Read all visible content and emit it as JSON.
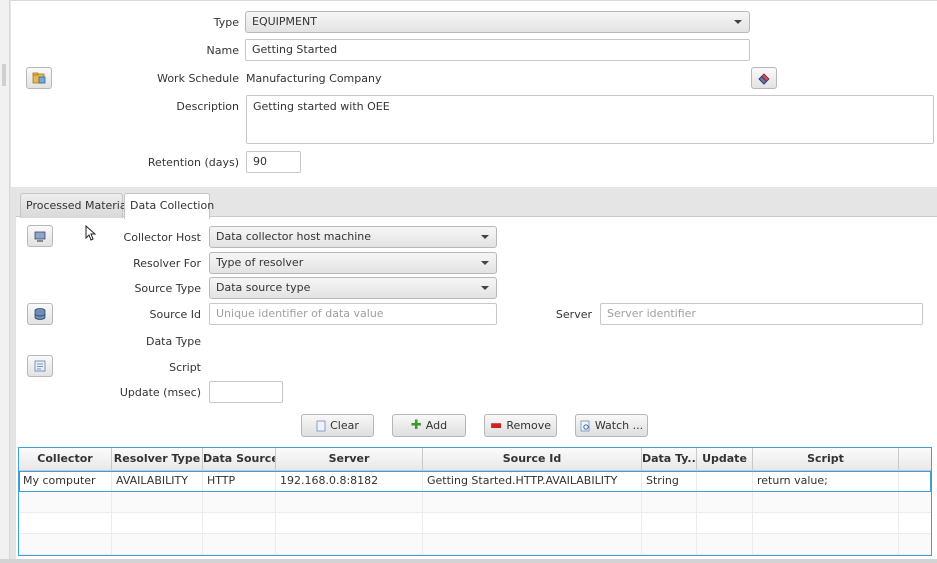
{
  "form": {
    "type_label": "Type",
    "type_value": "EQUIPMENT",
    "name_label": "Name",
    "name_value": "Getting Started",
    "work_schedule_label": "Work Schedule",
    "work_schedule_value": "Manufacturing Company",
    "description_label": "Description",
    "description_value": "Getting started with OEE",
    "retention_label": "Retention (days)",
    "retention_value": "90"
  },
  "tabs": [
    {
      "label": "Processed Material",
      "active": false
    },
    {
      "label": "Data Collection",
      "active": true
    }
  ],
  "data_collection": {
    "collector_host_label": "Collector Host",
    "collector_host_value": "Data collector host machine",
    "resolver_for_label": "Resolver For",
    "resolver_for_value": "Type of resolver",
    "source_type_label": "Source Type",
    "source_type_value": "Data source type",
    "source_id_label": "Source Id",
    "source_id_placeholder": "Unique identifier of data value",
    "server_label": "Server",
    "server_placeholder": "Server identifier",
    "data_type_label": "Data Type",
    "script_label": "Script",
    "update_label": "Update (msec)",
    "update_value": ""
  },
  "buttons": {
    "clear": "Clear",
    "add": "Add",
    "remove": "Remove",
    "watch": "Watch ..."
  },
  "table": {
    "columns": [
      "Collector",
      "Resolver Type",
      "Data Source",
      "Server",
      "Source Id",
      "Data Ty...",
      "Update",
      "Script",
      ""
    ],
    "rows": [
      [
        "My computer",
        "AVAILABILITY",
        "HTTP",
        "192.168.0.8:8182",
        "Getting Started.HTTP.AVAILABILITY",
        "String",
        "",
        "return value;",
        ""
      ]
    ]
  },
  "colors": {
    "accent": "#3f9fd6",
    "add_icon": "#3a9a2a",
    "remove_icon": "#cc2222"
  }
}
